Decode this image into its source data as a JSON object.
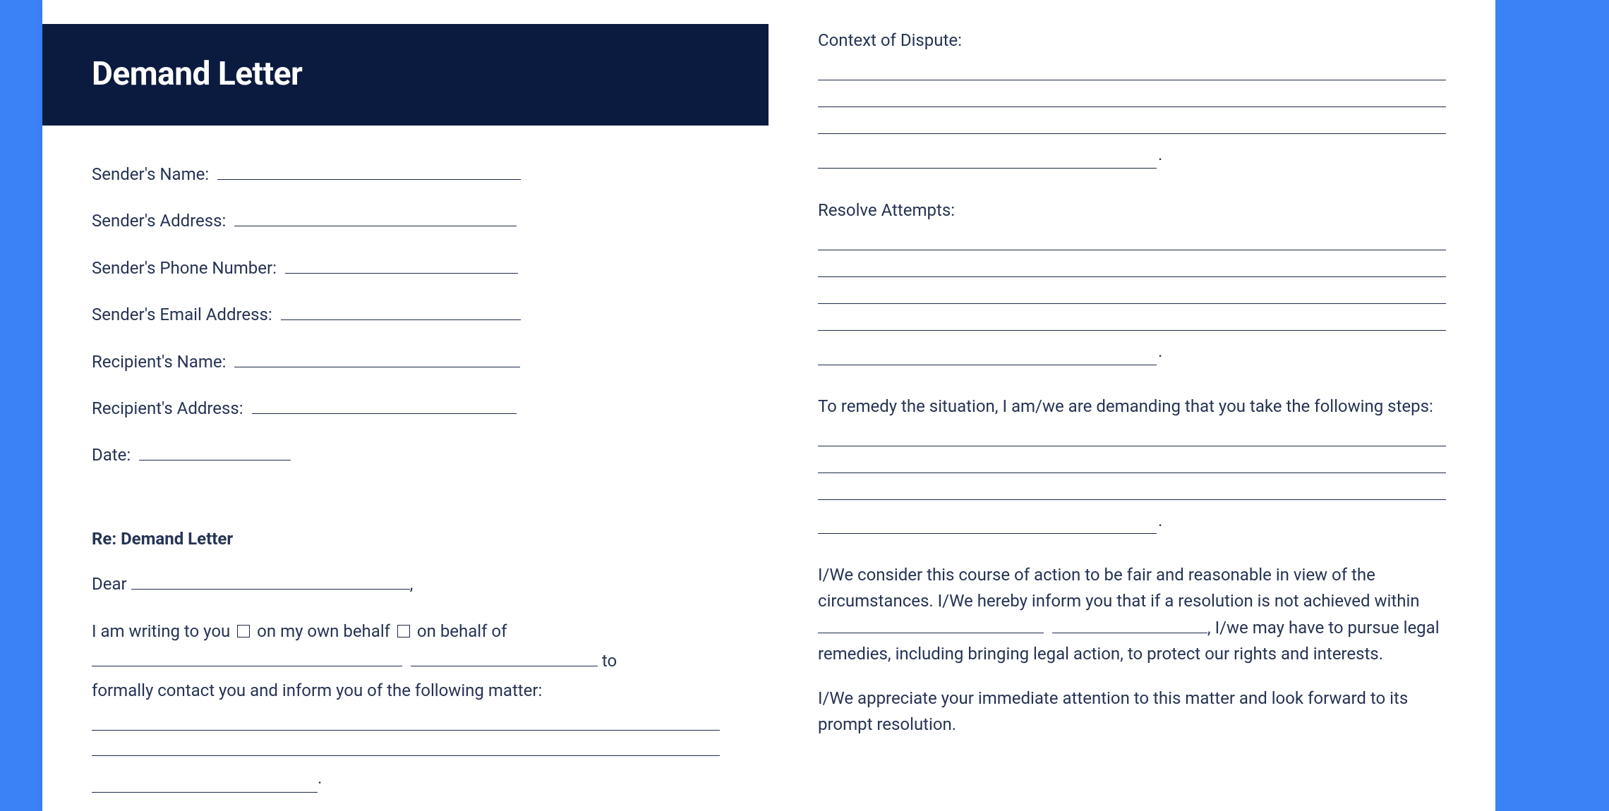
{
  "header": {
    "title": "Demand Letter"
  },
  "left": {
    "fields": {
      "sender_name": "Sender's Name:",
      "sender_address": "Sender's Address:",
      "sender_phone": "Sender's Phone Number:",
      "sender_email": "Sender's Email Address:",
      "recipient_name": "Recipient's Name:",
      "recipient_address": "Recipient's Address:",
      "date": "Date:"
    },
    "re_line": "Re: Demand Letter",
    "salutation_prefix": "Dear ",
    "salutation_suffix": ",",
    "body1_a": "I am writing to you ",
    "body1_opt1": " on my own behalf  ",
    "body1_opt2": " on behalf of",
    "body1_to": " to",
    "body1_b": "formally contact you and inform you of the following matter:"
  },
  "right": {
    "context_label": "Context of Dispute:",
    "resolve_label": "Resolve Attempts:",
    "remedy_intro": "To remedy the situation, I am/we are demanding that you take the following steps:",
    "fair_a": "I/We consider this course of action to be fair and reasonable in view of the circumstances. I/We hereby inform you that if a resolution is not achieved within ",
    "fair_b": ", I/we may have to pursue legal remedies, including bringing legal action, to protect our rights and interests.",
    "closing": "I/We appreciate your immediate attention to this matter and look forward to its prompt resolution."
  }
}
